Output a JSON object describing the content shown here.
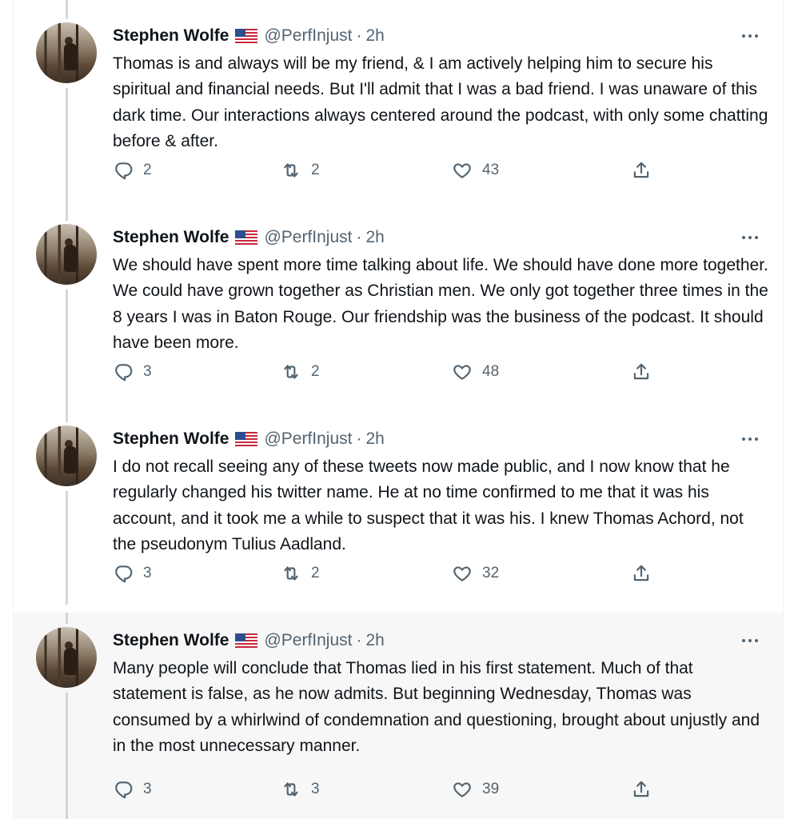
{
  "author": {
    "name": "Stephen Wolfe",
    "flag": "🇺🇸",
    "handle": "@PerfInjust",
    "separator": "·",
    "time": "2h"
  },
  "tweets": [
    {
      "text": "Thomas is and always will be my friend, & I am actively helping him to secure his spiritual and financial needs. But I'll admit that I was a bad friend. I was unaware of this dark time. Our interactions always centered around the podcast, with only some chatting before & after.",
      "replies": "2",
      "retweets": "2",
      "likes": "43"
    },
    {
      "text": "We should have spent more time talking about life. We should have done more together. We could have grown together as Christian men. We only got together three times in the 8 years I was in Baton Rouge. Our friendship was the business of the podcast. It should have been more.",
      "replies": "3",
      "retweets": "2",
      "likes": "48"
    },
    {
      "text": "I do not recall seeing any of these tweets now made public, and I now know that he regularly changed his twitter name. He at no time confirmed to me that it was his account, and it took me a while to suspect that it was his. I knew Thomas Achord, not the pseudonym Tulius Aadland.",
      "replies": "3",
      "retweets": "2",
      "likes": "32"
    },
    {
      "text": "Many people will conclude that Thomas lied in his first statement. Much of that statement is false, as he now admits. But beginning Wednesday, Thomas was consumed by a whirlwind of condemnation and questioning, brought about unjustly and in the most unnecessary manner.",
      "replies": "3",
      "retweets": "3",
      "likes": "39"
    }
  ],
  "colors": {
    "secondary_text": "#536471",
    "thread_line": "#cfd9de",
    "highlight_bg": "#f7f7f7"
  },
  "icons": [
    "reply-icon",
    "retweet-icon",
    "like-icon",
    "share-icon",
    "more-icon"
  ]
}
